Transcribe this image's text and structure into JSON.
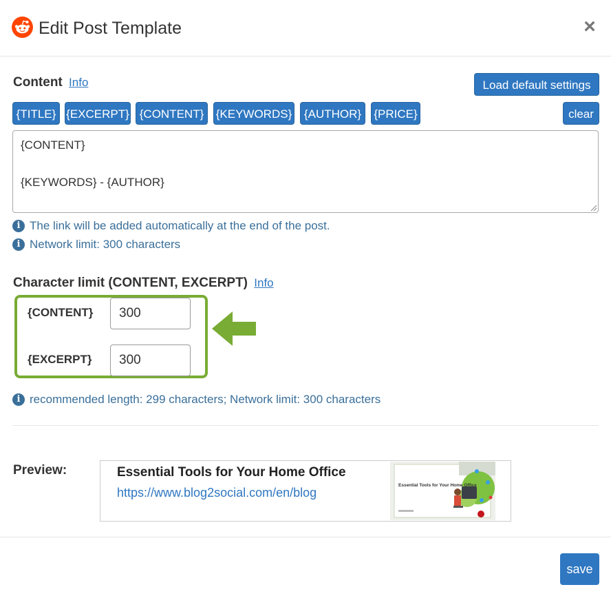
{
  "header": {
    "title": "Edit Post Template",
    "logo_icon": "reddit-logo-icon",
    "close_label": "×"
  },
  "content": {
    "label": "Content",
    "info_label": "Info",
    "load_default_label": "Load default settings",
    "placeholders": [
      "{TITLE}",
      "{EXCERPT}",
      "{CONTENT}",
      "{KEYWORDS}",
      "{AUTHOR}",
      "{PRICE}"
    ],
    "clear_label": "clear",
    "textarea_line1": "{CONTENT}",
    "textarea_line2": "{KEYWORDS} - {AUTHOR}",
    "info_auto_link": "The link will be added automatically at the end of the post.",
    "info_network_limit": "Network limit: 300 characters"
  },
  "char_limit": {
    "label": "Character limit (CONTENT, EXCERPT)",
    "info_label": "Info",
    "content_label": "{CONTENT}",
    "content_value": "300",
    "excerpt_label": "{EXCERPT}",
    "excerpt_value": "300",
    "recommended_text": "recommended length: 299 characters; Network limit: 300 characters"
  },
  "preview": {
    "label": "Preview:",
    "title": "Essential Tools for Your Home Office",
    "url": "https://www.blog2social.com/en/blog",
    "thumb_text": "Essential Tools for Your Home Office"
  },
  "footer": {
    "save_label": "save"
  },
  "colors": {
    "accent": "#2f77c1",
    "highlight_green": "#79ac34",
    "reddit_orange": "#ff4500",
    "info_text": "#3a6f9a"
  }
}
